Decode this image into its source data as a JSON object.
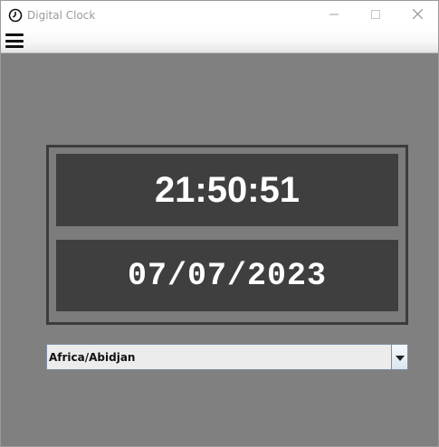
{
  "window": {
    "title": "Digital Clock"
  },
  "clock": {
    "time": "21:50:51",
    "date": "07/07/2023"
  },
  "timezone": {
    "selected": "Africa/Abidjan"
  },
  "icons": {
    "app": "clock-icon",
    "menu": "hamburger-menu-icon",
    "minimize": "minimize-icon",
    "maximize": "maximize-icon",
    "close": "close-icon",
    "dropdown": "chevron-down-icon"
  },
  "colors": {
    "background": "#808080",
    "display_background": "#3f3f3f",
    "display_text": "#ffffff"
  }
}
